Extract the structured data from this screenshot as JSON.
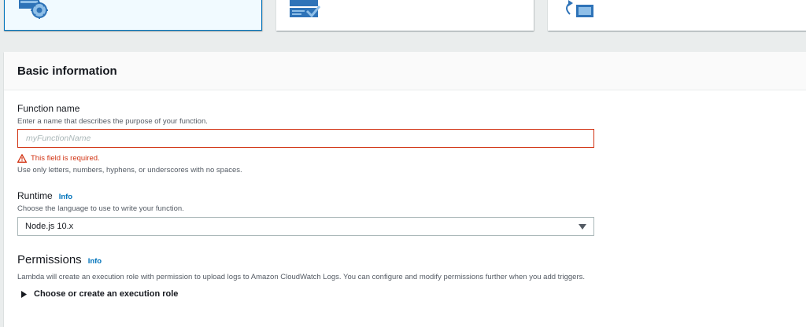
{
  "basic": {
    "title": "Basic information",
    "function_name": {
      "label": "Function name",
      "description": "Enter a name that describes the purpose of your function.",
      "placeholder": "myFunctionName",
      "value": "",
      "error": "This field is required.",
      "hint": "Use only letters, numbers, hyphens, or underscores with no spaces."
    },
    "runtime": {
      "label": "Runtime",
      "info": "Info",
      "description": "Choose the language to use to write your function.",
      "selected": "Node.js 10.x"
    }
  },
  "permissions": {
    "title": "Permissions",
    "info": "Info",
    "description": "Lambda will create an execution role with permission to upload logs to Amazon CloudWatch Logs. You can configure and modify permissions further when you add triggers.",
    "expander": "Choose or create an execution role"
  },
  "colors": {
    "accent": "#0073bb",
    "error": "#d13212",
    "icon_blue": "#2e73b8",
    "icon_light": "#8fbfe8"
  }
}
